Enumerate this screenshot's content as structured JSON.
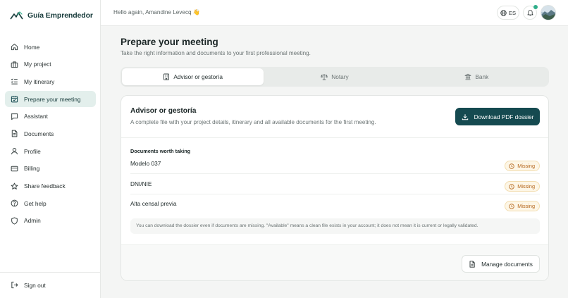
{
  "brand": {
    "name": "Guía Emprendedor",
    "logo_icon": "mountain-logo-icon"
  },
  "sidebar": {
    "items": [
      {
        "label": "Home",
        "icon": "home-icon",
        "active": false
      },
      {
        "label": "My project",
        "icon": "briefcase-icon",
        "active": false
      },
      {
        "label": "My itinerary",
        "icon": "checklist-icon",
        "active": false
      },
      {
        "label": "Prepare your meeting",
        "icon": "calendar-check-icon",
        "active": true
      },
      {
        "label": "Assistant",
        "icon": "chat-icon",
        "active": false
      },
      {
        "label": "Documents",
        "icon": "document-icon",
        "active": false
      },
      {
        "label": "Profile",
        "icon": "user-icon",
        "active": false
      },
      {
        "label": "Billing",
        "icon": "credit-card-icon",
        "active": false
      },
      {
        "label": "Share feedback",
        "icon": "star-icon",
        "active": false
      },
      {
        "label": "Get help",
        "icon": "help-circle-icon",
        "active": false
      },
      {
        "label": "Admin",
        "icon": "shield-icon",
        "active": false
      }
    ],
    "signout_label": "Sign out"
  },
  "header": {
    "greeting": "Hello again, Amandine Levecq 👋",
    "language": "ES",
    "has_notification": true
  },
  "page": {
    "title": "Prepare your meeting",
    "subtitle": "Take the right information and documents to your first professional meeting."
  },
  "tabs": [
    {
      "label": "Advisor or gestoría",
      "icon": "building-icon",
      "active": true
    },
    {
      "label": "Notary",
      "icon": "scale-icon",
      "active": false
    },
    {
      "label": "Bank",
      "icon": "bank-icon",
      "active": false
    }
  ],
  "card": {
    "title": "Advisor or gestoría",
    "description": "A complete file with your project details, itinerary and all available documents for the first meeting.",
    "download_label": "Download PDF dossier",
    "docs_heading": "Documents worth taking",
    "documents": [
      {
        "name": "Modelo 037",
        "status": "Missing"
      },
      {
        "name": "DNI/NIE",
        "status": "Missing"
      },
      {
        "name": "Alta censal previa",
        "status": "Missing"
      }
    ],
    "note": "You can download the dossier even if documents are missing. \"Available\" means a clean file exists in your account; it does not mean it is current or legally validated.",
    "manage_label": "Manage documents"
  },
  "colors": {
    "accent": "#154a50",
    "active_nav_bg": "#e3efec",
    "missing_badge": "#b4651a",
    "notification_dot": "#2fae8a"
  }
}
